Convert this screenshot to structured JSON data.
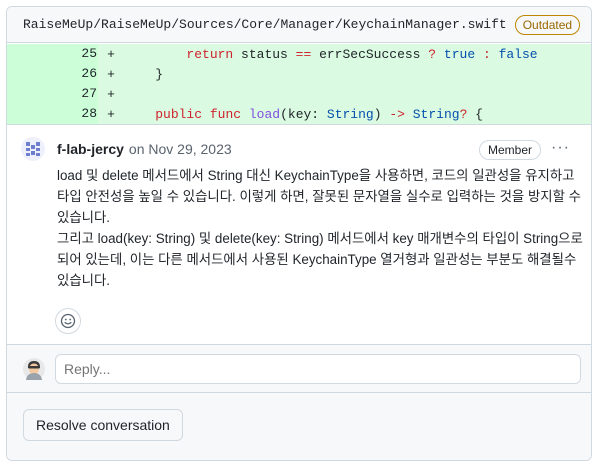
{
  "file": {
    "path": "RaiseMeUp/RaiseMeUp/Sources/Core/Manager/KeychainManager.swift",
    "badge": "Outdated"
  },
  "diff": {
    "lines": [
      {
        "number": "25",
        "marker": "+",
        "indent": "        ",
        "tokens": [
          {
            "t": "kw",
            "v": "return"
          },
          {
            "t": "code",
            "v": " status "
          },
          {
            "t": "kw",
            "v": "=="
          },
          {
            "t": "code",
            "v": " errSecSuccess "
          },
          {
            "t": "kw",
            "v": "?"
          },
          {
            "t": "code",
            "v": " "
          },
          {
            "t": "ty",
            "v": "true"
          },
          {
            "t": "code",
            "v": " "
          },
          {
            "t": "kw",
            "v": ":"
          },
          {
            "t": "code",
            "v": " "
          },
          {
            "t": "ty",
            "v": "false"
          }
        ]
      },
      {
        "number": "26",
        "marker": "+",
        "indent": "    ",
        "tokens": [
          {
            "t": "code",
            "v": "}"
          }
        ]
      },
      {
        "number": "27",
        "marker": "+",
        "indent": "",
        "tokens": []
      },
      {
        "number": "28",
        "marker": "+",
        "indent": "    ",
        "tokens": [
          {
            "t": "kw",
            "v": "public"
          },
          {
            "t": "code",
            "v": " "
          },
          {
            "t": "kw",
            "v": "func"
          },
          {
            "t": "code",
            "v": " "
          },
          {
            "t": "fn",
            "v": "load"
          },
          {
            "t": "code",
            "v": "(key: "
          },
          {
            "t": "ty",
            "v": "String"
          },
          {
            "t": "code",
            "v": ") "
          },
          {
            "t": "kw",
            "v": "->"
          },
          {
            "t": "code",
            "v": " "
          },
          {
            "t": "ty",
            "v": "String"
          },
          {
            "t": "kw",
            "v": "?"
          },
          {
            "t": "code",
            "v": " {"
          }
        ]
      }
    ]
  },
  "comment": {
    "author": "f-lab-jercy",
    "date": "on Nov 29, 2023",
    "role": "Member",
    "menu_icon": "kebab-horizontal-icon",
    "paragraph1": "load 및 delete 메서드에서 String 대신 KeychainType을 사용하면, 코드의 일관성을 유지하고 타입 안전성을 높일 수 있습니다. 이렇게 하면, 잘못된 문자열을 실수로 입력하는 것을 방지할 수 있습니다.",
    "paragraph2": "그리고 load(key: String) 및 delete(key: String) 메서드에서 key 매개변수의 타입이 String으로 되어 있는데, 이는 다른 메서드에서 사용된 KeychainType 열거형과 일관성는 부분도 해결될수 있습니다.",
    "reaction_icon": "smiley-icon"
  },
  "reply": {
    "placeholder": "Reply..."
  },
  "resolve": {
    "label": "Resolve conversation"
  },
  "colors": {
    "diff_added_bg": "#dafbe1",
    "diff_added_number_bg": "#ccffd8",
    "outdated": "#9a6700",
    "avatar_identicon": "#6f7fcf"
  }
}
